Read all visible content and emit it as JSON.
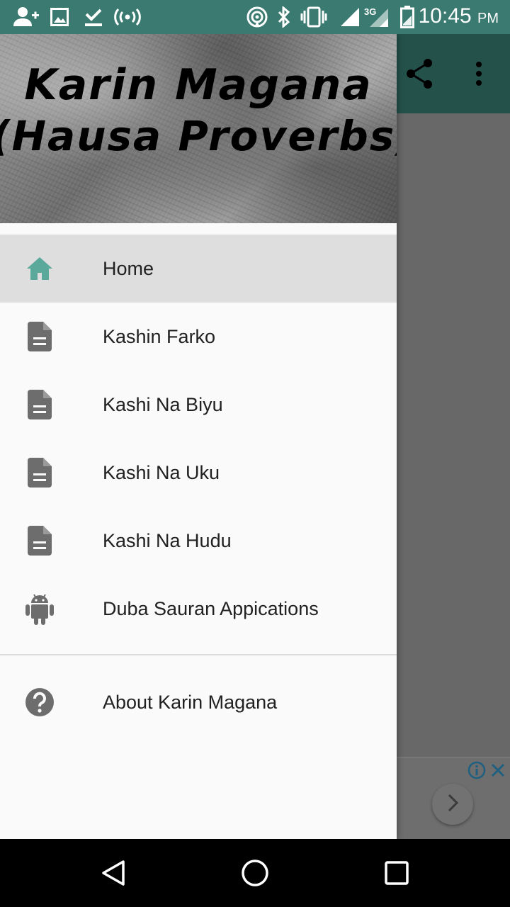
{
  "status_bar": {
    "time": "10:45",
    "ampm": "PM",
    "network": "3G",
    "icons": [
      "add-person-icon",
      "image-icon",
      "download-done-icon",
      "hotspot-icon",
      "location-icon",
      "bluetooth-icon",
      "vibrate-icon",
      "signal-icon",
      "signal-3g-icon",
      "battery-icon"
    ]
  },
  "app_bar": {
    "icons": [
      "share-icon",
      "more-vert-icon"
    ]
  },
  "drawer": {
    "header": {
      "title": "Karin Magana",
      "subtitle": "(Hausa Proverbs)"
    },
    "items": [
      {
        "label": "Home",
        "icon": "home-icon",
        "active": true
      },
      {
        "label": "Kashin Farko",
        "icon": "document-icon"
      },
      {
        "label": "Kashi Na Biyu",
        "icon": "document-icon"
      },
      {
        "label": "Kashi Na Uku",
        "icon": "document-icon"
      },
      {
        "label": "Kashi Na Hudu",
        "icon": "document-icon"
      },
      {
        "label": "Duba Sauran Appications",
        "icon": "android-icon"
      }
    ],
    "footer_items": [
      {
        "label": "About Karin Magana",
        "icon": "help-icon"
      }
    ]
  },
  "ad": {
    "icons": [
      "info-icon",
      "close-icon",
      "chevron-right-icon"
    ]
  },
  "navigation_bar": {
    "buttons": [
      "back-icon",
      "home-circle-icon",
      "recents-icon"
    ]
  },
  "colors": {
    "status_bar": "#3a7a70",
    "accent": "#5aa99b",
    "icon_grey": "#6d6d6d",
    "active_row": "#dedede"
  }
}
